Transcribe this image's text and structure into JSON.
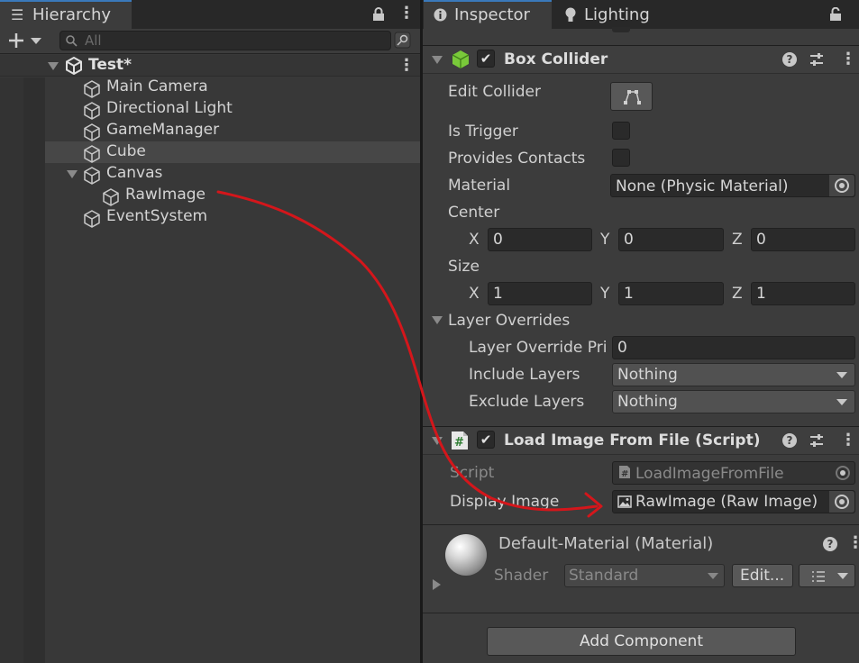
{
  "hierarchy": {
    "tab_label": "Hierarchy",
    "search_placeholder": "All",
    "scene_name": "Test*",
    "items": [
      {
        "label": "Main Camera"
      },
      {
        "label": "Directional Light"
      },
      {
        "label": "GameManager"
      },
      {
        "label": "Cube"
      },
      {
        "label": "Canvas"
      },
      {
        "label": "RawImage"
      },
      {
        "label": "EventSystem"
      }
    ]
  },
  "inspector": {
    "tabs": [
      {
        "label": "Inspector"
      },
      {
        "label": "Lighting"
      }
    ],
    "box_collider": {
      "title": "Box Collider",
      "edit_collider_label": "Edit Collider",
      "is_trigger_label": "Is Trigger",
      "provides_contacts_label": "Provides Contacts",
      "material_label": "Material",
      "material_value": "None (Physic Material)",
      "center_label": "Center",
      "center": {
        "x_label": "X",
        "x": "0",
        "y_label": "Y",
        "y": "0",
        "z_label": "Z",
        "z": "0"
      },
      "size_label": "Size",
      "size": {
        "x_label": "X",
        "x": "1",
        "y_label": "Y",
        "y": "1",
        "z_label": "Z",
        "z": "1"
      },
      "layer_overrides_label": "Layer Overrides",
      "layer_override_priority_label": "Layer Override Pri",
      "layer_override_priority_value": "0",
      "include_layers_label": "Include Layers",
      "include_layers_value": "Nothing",
      "exclude_layers_label": "Exclude Layers",
      "exclude_layers_value": "Nothing"
    },
    "load_image": {
      "title": "Load Image From File (Script)",
      "script_label": "Script",
      "script_value": "LoadImageFromFile",
      "display_image_label": "Display Image",
      "display_image_value": "RawImage (Raw Image)"
    },
    "material": {
      "title": "Default-Material (Material)",
      "shader_label": "Shader",
      "shader_value": "Standard",
      "edit_button": "Edit..."
    },
    "add_component_label": "Add Component"
  },
  "colors": {
    "annotation_arrow": "#d4161b",
    "tab_accent": "#3a79bb"
  }
}
